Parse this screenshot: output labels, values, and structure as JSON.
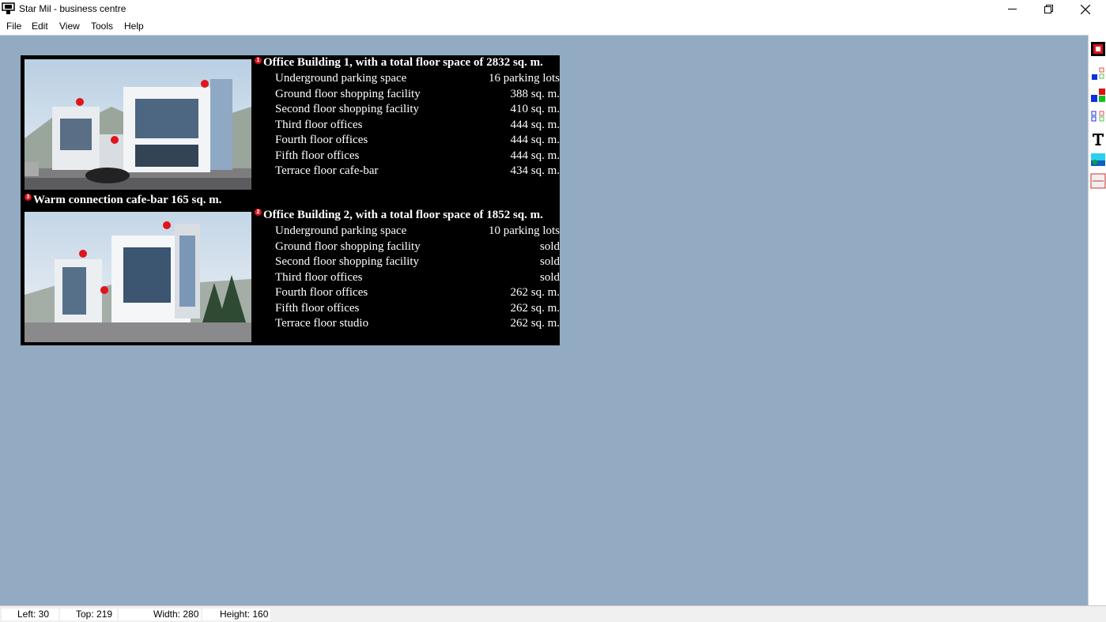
{
  "window": {
    "title": "Star Mil - business centre"
  },
  "menu": [
    "File",
    "Edit",
    "View",
    "Tools",
    "Help"
  ],
  "building1": {
    "marker": "1",
    "title": "Office Building 1, with a total floor space of 2832 sq. m.",
    "rows": [
      {
        "label": "Underground parking space",
        "value": "16 parking lots"
      },
      {
        "label": "Ground floor shopping facility",
        "value": "388 sq. m."
      },
      {
        "label": "Second floor shopping facility",
        "value": "410 sq. m."
      },
      {
        "label": "Third floor offices",
        "value": "444 sq. m."
      },
      {
        "label": "Fourth floor offices",
        "value": "444 sq. m."
      },
      {
        "label": "Fifth floor offices",
        "value": "444 sq. m."
      },
      {
        "label": "Terrace floor cafe-bar",
        "value": "434 sq. m."
      }
    ]
  },
  "connection": {
    "marker": "3",
    "title": "Warm connection cafe-bar 165 sq. m."
  },
  "building2": {
    "marker": "2",
    "title": "Office Building 2, with a total floor space of 1852 sq. m.",
    "rows": [
      {
        "label": "Underground parking space",
        "value": "10 parking lots"
      },
      {
        "label": "Ground floor shopping facility",
        "value": "sold"
      },
      {
        "label": "Second floor shopping facility",
        "value": "sold"
      },
      {
        "label": "Third floor offices",
        "value": "sold"
      },
      {
        "label": "Fourth floor offices",
        "value": "262 sq. m."
      },
      {
        "label": "Fifth floor offices",
        "value": "262 sq. m."
      },
      {
        "label": "Terrace floor studio",
        "value": "262 sq. m."
      }
    ]
  },
  "status": {
    "left": "Left: 30",
    "top": "Top: 219",
    "width": "Width: 280",
    "height": "Height: 160"
  },
  "toolbar_icons": [
    "red-box-tool-icon",
    "shapes-small-icon",
    "shapes-color-icon",
    "shapes-small-2-icon",
    "text-tool-icon",
    "image-tool-icon",
    "frame-tool-icon"
  ],
  "colors": {
    "canvas": "#92abc2",
    "panel": "#000000",
    "marker": "#e0141c"
  }
}
